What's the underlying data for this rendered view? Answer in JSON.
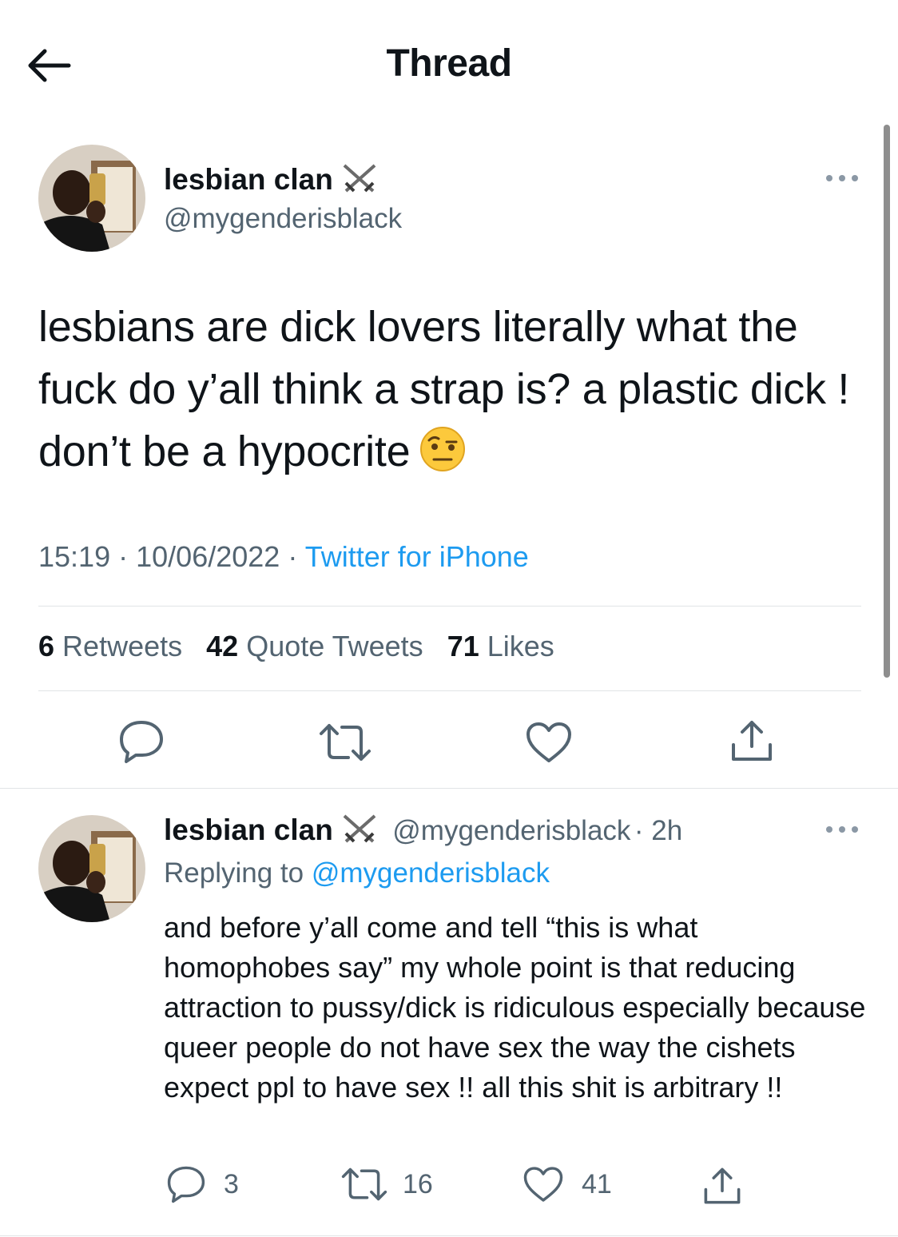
{
  "header": {
    "title": "Thread"
  },
  "main_tweet": {
    "name": "lesbian clan",
    "handle": "@mygenderisblack",
    "text": "lesbians are dick lovers literally what the fuck do y’all think a strap is? a plastic dick ! don’t be a hypocrite",
    "emoji": "face-with-raised-eyebrow",
    "time": "15:19",
    "date": "10/06/2022",
    "source": "Twitter for iPhone",
    "sep": "·",
    "stats": {
      "retweets_count": "6",
      "retweets_label": "Retweets",
      "quotes_count": "42",
      "quotes_label": "Quote Tweets",
      "likes_count": "71",
      "likes_label": "Likes"
    }
  },
  "reply_tweet": {
    "name": "lesbian clan",
    "handle": "@mygenderisblack",
    "time": "· 2h",
    "replying_prefix": "Replying to",
    "replying_handle": "@mygenderisblack",
    "text": "and before y’all come and tell “this is what homophobes say” my whole point is that reducing attraction to pussy/dick is ridiculous especially because queer people do not have sex the way the cishets expect ppl to have sex !! all this shit is arbitrary !!",
    "reply_count": "3",
    "retweet_count": "16",
    "like_count": "41"
  },
  "colors": {
    "link": "#1d9bf0",
    "secondary_text": "#536471",
    "divider": "#e1e4e6"
  }
}
